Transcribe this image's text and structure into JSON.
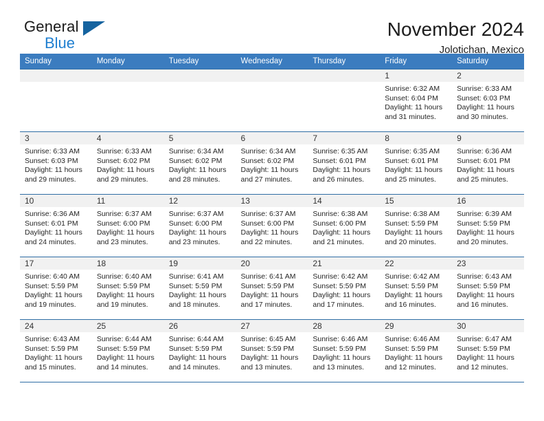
{
  "brand": {
    "word1": "General",
    "word2": "Blue",
    "logo_icon": "triangle-flag-icon"
  },
  "header": {
    "title": "November 2024",
    "subtitle": "Jolotichan, Mexico"
  },
  "colors": {
    "header_blue": "#3b7cbf",
    "row_border_blue": "#2e6da4",
    "daynum_bg": "#f1f1f1",
    "brand_blue": "#1f7fd0"
  },
  "weekdays": [
    "Sunday",
    "Monday",
    "Tuesday",
    "Wednesday",
    "Thursday",
    "Friday",
    "Saturday"
  ],
  "labels": {
    "sunrise": "Sunrise:",
    "sunset": "Sunset:",
    "daylight": "Daylight:"
  },
  "weeks": [
    [
      {
        "day": "",
        "empty": true
      },
      {
        "day": "",
        "empty": true
      },
      {
        "day": "",
        "empty": true
      },
      {
        "day": "",
        "empty": true
      },
      {
        "day": "",
        "empty": true
      },
      {
        "day": "1",
        "sunrise": "Sunrise: 6:32 AM",
        "sunset": "Sunset: 6:04 PM",
        "daylight1": "Daylight: 11 hours",
        "daylight2": "and 31 minutes."
      },
      {
        "day": "2",
        "sunrise": "Sunrise: 6:33 AM",
        "sunset": "Sunset: 6:03 PM",
        "daylight1": "Daylight: 11 hours",
        "daylight2": "and 30 minutes."
      }
    ],
    [
      {
        "day": "3",
        "sunrise": "Sunrise: 6:33 AM",
        "sunset": "Sunset: 6:03 PM",
        "daylight1": "Daylight: 11 hours",
        "daylight2": "and 29 minutes."
      },
      {
        "day": "4",
        "sunrise": "Sunrise: 6:33 AM",
        "sunset": "Sunset: 6:02 PM",
        "daylight1": "Daylight: 11 hours",
        "daylight2": "and 29 minutes."
      },
      {
        "day": "5",
        "sunrise": "Sunrise: 6:34 AM",
        "sunset": "Sunset: 6:02 PM",
        "daylight1": "Daylight: 11 hours",
        "daylight2": "and 28 minutes."
      },
      {
        "day": "6",
        "sunrise": "Sunrise: 6:34 AM",
        "sunset": "Sunset: 6:02 PM",
        "daylight1": "Daylight: 11 hours",
        "daylight2": "and 27 minutes."
      },
      {
        "day": "7",
        "sunrise": "Sunrise: 6:35 AM",
        "sunset": "Sunset: 6:01 PM",
        "daylight1": "Daylight: 11 hours",
        "daylight2": "and 26 minutes."
      },
      {
        "day": "8",
        "sunrise": "Sunrise: 6:35 AM",
        "sunset": "Sunset: 6:01 PM",
        "daylight1": "Daylight: 11 hours",
        "daylight2": "and 25 minutes."
      },
      {
        "day": "9",
        "sunrise": "Sunrise: 6:36 AM",
        "sunset": "Sunset: 6:01 PM",
        "daylight1": "Daylight: 11 hours",
        "daylight2": "and 25 minutes."
      }
    ],
    [
      {
        "day": "10",
        "sunrise": "Sunrise: 6:36 AM",
        "sunset": "Sunset: 6:01 PM",
        "daylight1": "Daylight: 11 hours",
        "daylight2": "and 24 minutes."
      },
      {
        "day": "11",
        "sunrise": "Sunrise: 6:37 AM",
        "sunset": "Sunset: 6:00 PM",
        "daylight1": "Daylight: 11 hours",
        "daylight2": "and 23 minutes."
      },
      {
        "day": "12",
        "sunrise": "Sunrise: 6:37 AM",
        "sunset": "Sunset: 6:00 PM",
        "daylight1": "Daylight: 11 hours",
        "daylight2": "and 23 minutes."
      },
      {
        "day": "13",
        "sunrise": "Sunrise: 6:37 AM",
        "sunset": "Sunset: 6:00 PM",
        "daylight1": "Daylight: 11 hours",
        "daylight2": "and 22 minutes."
      },
      {
        "day": "14",
        "sunrise": "Sunrise: 6:38 AM",
        "sunset": "Sunset: 6:00 PM",
        "daylight1": "Daylight: 11 hours",
        "daylight2": "and 21 minutes."
      },
      {
        "day": "15",
        "sunrise": "Sunrise: 6:38 AM",
        "sunset": "Sunset: 5:59 PM",
        "daylight1": "Daylight: 11 hours",
        "daylight2": "and 20 minutes."
      },
      {
        "day": "16",
        "sunrise": "Sunrise: 6:39 AM",
        "sunset": "Sunset: 5:59 PM",
        "daylight1": "Daylight: 11 hours",
        "daylight2": "and 20 minutes."
      }
    ],
    [
      {
        "day": "17",
        "sunrise": "Sunrise: 6:40 AM",
        "sunset": "Sunset: 5:59 PM",
        "daylight1": "Daylight: 11 hours",
        "daylight2": "and 19 minutes."
      },
      {
        "day": "18",
        "sunrise": "Sunrise: 6:40 AM",
        "sunset": "Sunset: 5:59 PM",
        "daylight1": "Daylight: 11 hours",
        "daylight2": "and 19 minutes."
      },
      {
        "day": "19",
        "sunrise": "Sunrise: 6:41 AM",
        "sunset": "Sunset: 5:59 PM",
        "daylight1": "Daylight: 11 hours",
        "daylight2": "and 18 minutes."
      },
      {
        "day": "20",
        "sunrise": "Sunrise: 6:41 AM",
        "sunset": "Sunset: 5:59 PM",
        "daylight1": "Daylight: 11 hours",
        "daylight2": "and 17 minutes."
      },
      {
        "day": "21",
        "sunrise": "Sunrise: 6:42 AM",
        "sunset": "Sunset: 5:59 PM",
        "daylight1": "Daylight: 11 hours",
        "daylight2": "and 17 minutes."
      },
      {
        "day": "22",
        "sunrise": "Sunrise: 6:42 AM",
        "sunset": "Sunset: 5:59 PM",
        "daylight1": "Daylight: 11 hours",
        "daylight2": "and 16 minutes."
      },
      {
        "day": "23",
        "sunrise": "Sunrise: 6:43 AM",
        "sunset": "Sunset: 5:59 PM",
        "daylight1": "Daylight: 11 hours",
        "daylight2": "and 16 minutes."
      }
    ],
    [
      {
        "day": "24",
        "sunrise": "Sunrise: 6:43 AM",
        "sunset": "Sunset: 5:59 PM",
        "daylight1": "Daylight: 11 hours",
        "daylight2": "and 15 minutes."
      },
      {
        "day": "25",
        "sunrise": "Sunrise: 6:44 AM",
        "sunset": "Sunset: 5:59 PM",
        "daylight1": "Daylight: 11 hours",
        "daylight2": "and 14 minutes."
      },
      {
        "day": "26",
        "sunrise": "Sunrise: 6:44 AM",
        "sunset": "Sunset: 5:59 PM",
        "daylight1": "Daylight: 11 hours",
        "daylight2": "and 14 minutes."
      },
      {
        "day": "27",
        "sunrise": "Sunrise: 6:45 AM",
        "sunset": "Sunset: 5:59 PM",
        "daylight1": "Daylight: 11 hours",
        "daylight2": "and 13 minutes."
      },
      {
        "day": "28",
        "sunrise": "Sunrise: 6:46 AM",
        "sunset": "Sunset: 5:59 PM",
        "daylight1": "Daylight: 11 hours",
        "daylight2": "and 13 minutes."
      },
      {
        "day": "29",
        "sunrise": "Sunrise: 6:46 AM",
        "sunset": "Sunset: 5:59 PM",
        "daylight1": "Daylight: 11 hours",
        "daylight2": "and 12 minutes."
      },
      {
        "day": "30",
        "sunrise": "Sunrise: 6:47 AM",
        "sunset": "Sunset: 5:59 PM",
        "daylight1": "Daylight: 11 hours",
        "daylight2": "and 12 minutes."
      }
    ]
  ]
}
